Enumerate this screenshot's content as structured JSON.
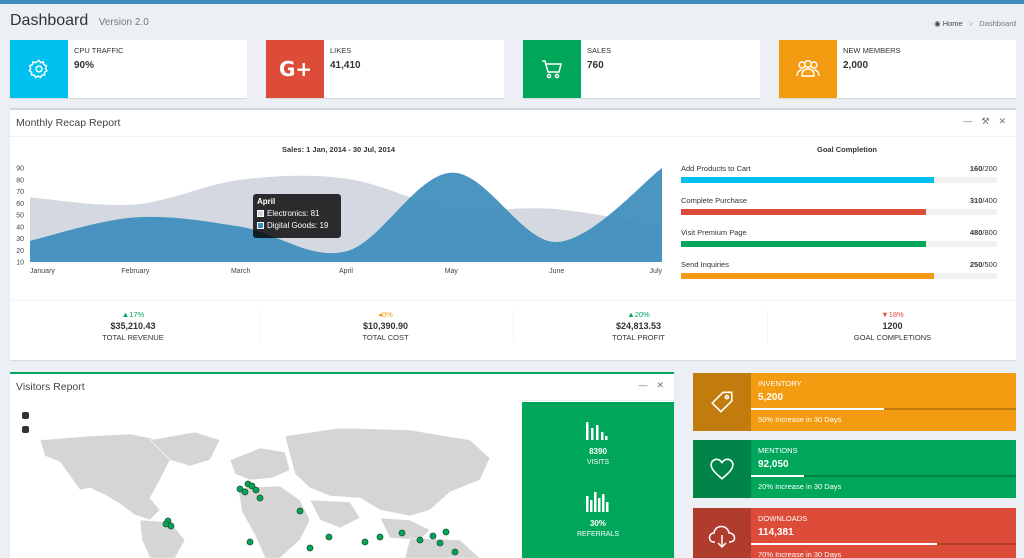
{
  "header": {
    "title": "Dashboard",
    "version": "Version 2.0"
  },
  "breadcrumb": {
    "home": "Home",
    "current": "Dashboard"
  },
  "info_boxes": [
    {
      "label": "CPU TRAFFIC",
      "value": "90%",
      "icon": "gear-icon",
      "color": "#00c0ef"
    },
    {
      "label": "LIKES",
      "value": "41,410",
      "icon": "google-plus-icon",
      "color": "#dd4b39"
    },
    {
      "label": "SALES",
      "value": "760",
      "icon": "cart-icon",
      "color": "#00a65a"
    },
    {
      "label": "NEW MEMBERS",
      "value": "2,000",
      "icon": "users-icon",
      "color": "#f39c12"
    }
  ],
  "recap": {
    "title": "Monthly Recap Report",
    "chart_heading": "Sales: 1 Jan, 2014 - 30 Jul, 2014",
    "goal_heading": "Goal Completion",
    "tooltip": {
      "title": "April",
      "line1": "Electronics: 81",
      "line2": "Digital Goods: 19"
    }
  },
  "chart_data": {
    "type": "area",
    "title": "Sales: 1 Jan, 2014 - 30 Jul, 2014",
    "categories": [
      "January",
      "February",
      "March",
      "April",
      "May",
      "June",
      "July"
    ],
    "ylim": [
      10,
      90
    ],
    "yticks": [
      10,
      20,
      30,
      40,
      50,
      60,
      70,
      80,
      90
    ],
    "series": [
      {
        "name": "Electronics",
        "values": [
          65,
          59,
          80,
          81,
          56,
          55,
          40
        ],
        "color": "#d2d6de"
      },
      {
        "name": "Digital Goods",
        "values": [
          28,
          48,
          40,
          19,
          86,
          27,
          90
        ],
        "color": "#3c8dbc"
      }
    ]
  },
  "goals": [
    {
      "label": "Add Products to Cart",
      "done": "160",
      "total": "/200",
      "fraction": 0.8,
      "color": "#00c0ef"
    },
    {
      "label": "Complete Purchase",
      "done": "310",
      "total": "/400",
      "fraction": 0.775,
      "color": "#dd4b39"
    },
    {
      "label": "Visit Premium Page",
      "done": "480",
      "total": "/800",
      "fraction": 0.775,
      "color": "#00a65a"
    },
    {
      "label": "Send Inquiries",
      "done": "250",
      "total": "/500",
      "fraction": 0.8,
      "color": "#f39c12"
    }
  ],
  "stats": [
    {
      "pct": "▲17%",
      "value": "$35,210.43",
      "label": "TOTAL REVENUE",
      "color": "#00a65a"
    },
    {
      "pct": "◂0%",
      "value": "$10,390.90",
      "label": "TOTAL COST",
      "color": "#f39c12"
    },
    {
      "pct": "▲20%",
      "value": "$24,813.53",
      "label": "TOTAL PROFIT",
      "color": "#00a65a"
    },
    {
      "pct": "▼18%",
      "value": "1200",
      "label": "GOAL COMPLETIONS",
      "color": "#dd4b39"
    }
  ],
  "visitors": {
    "title": "Visitors Report",
    "visits_value": "8390",
    "visits_label": "VISITS",
    "referrals_value": "30%",
    "referrals_label": "REFERRALS"
  },
  "side_boxes": [
    {
      "label": "INVENTORY",
      "value": "5,200",
      "desc": "50% Increase in 30 Days",
      "progress": 0.5,
      "icon": "tag-icon",
      "color": "#f39c12"
    },
    {
      "label": "MENTIONS",
      "value": "92,050",
      "desc": "20% Increase in 30 Days",
      "progress": 0.2,
      "icon": "heart-icon",
      "color": "#00a65a"
    },
    {
      "label": "DOWNLOADS",
      "value": "114,381",
      "desc": "70% Increase in 30 Days",
      "progress": 0.7,
      "icon": "cloud-download-icon",
      "color": "#dd4b39"
    }
  ]
}
